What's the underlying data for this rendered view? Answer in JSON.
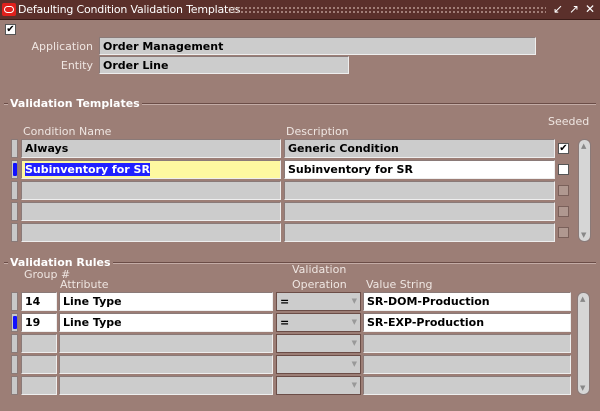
{
  "window": {
    "title": "Defaulting Condition Validation Templates",
    "controls": [
      "minimize",
      "maximize",
      "close"
    ]
  },
  "header": {
    "checked": true,
    "application_label": "Application",
    "application_value": "Order Management",
    "entity_label": "Entity",
    "entity_value": "Order Line"
  },
  "templates": {
    "section_title": "Validation Templates",
    "col_condition": "Condition Name",
    "col_description": "Description",
    "col_seeded": "Seeded",
    "rows": [
      {
        "condition": "Always",
        "description": "Generic Condition",
        "seeded": true
      },
      {
        "condition": "Subinventory for SR",
        "description": "Subinventory for SR",
        "seeded": false,
        "current": true
      },
      {
        "condition": "",
        "description": "",
        "seeded": false
      },
      {
        "condition": "",
        "description": "",
        "seeded": false
      },
      {
        "condition": "",
        "description": "",
        "seeded": false
      }
    ]
  },
  "rules": {
    "section_title": "Validation Rules",
    "col_group": "Group #",
    "col_attribute": "Attribute",
    "col_operation_1": "Validation",
    "col_operation_2": "Operation",
    "col_value": "Value String",
    "rows": [
      {
        "group": "14",
        "attribute": "Line Type",
        "operation": "=",
        "value": "SR-DOM-Production"
      },
      {
        "group": "19",
        "attribute": "Line Type",
        "operation": "=",
        "value": "SR-EXP-Production",
        "current": true
      },
      {
        "group": "",
        "attribute": "",
        "operation": "",
        "value": ""
      },
      {
        "group": "",
        "attribute": "",
        "operation": "",
        "value": ""
      },
      {
        "group": "",
        "attribute": "",
        "operation": "",
        "value": ""
      }
    ]
  }
}
